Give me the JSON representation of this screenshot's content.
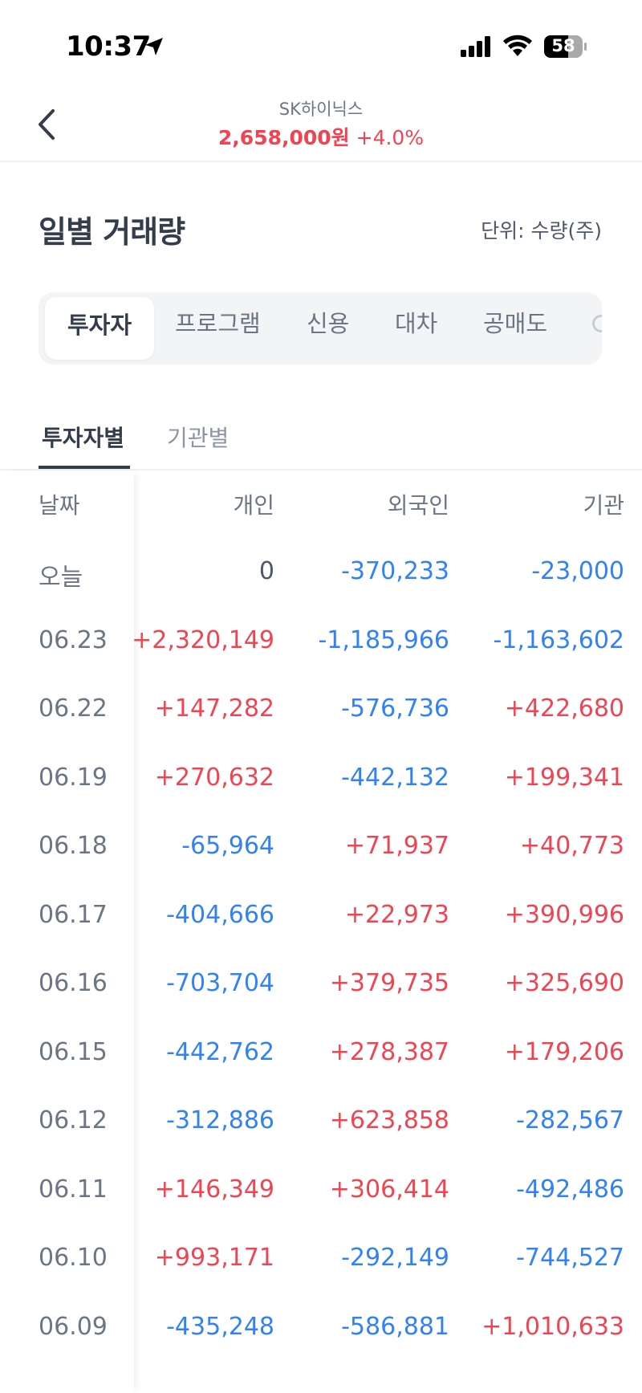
{
  "status_bar": {
    "time": "10:37",
    "battery": "58"
  },
  "header": {
    "stock_name": "SK하이닉스",
    "price": "2,658,000원",
    "change": "+4.0%"
  },
  "section": {
    "title": "일별 거래량",
    "unit": "단위: 수량(주)"
  },
  "segment_tabs": [
    "투자자",
    "프로그램",
    "신용",
    "대차",
    "공매도"
  ],
  "sub_tabs": [
    "투자자별",
    "기관별"
  ],
  "table": {
    "headers": [
      "날짜",
      "개인",
      "외국인",
      "기관"
    ],
    "rows": [
      {
        "date": "오늘",
        "individual": "0",
        "foreign": "-370,233",
        "institution": "-23,000"
      },
      {
        "date": "06.23",
        "individual": "+2,320,149",
        "foreign": "-1,185,966",
        "institution": "-1,163,602"
      },
      {
        "date": "06.22",
        "individual": "+147,282",
        "foreign": "-576,736",
        "institution": "+422,680"
      },
      {
        "date": "06.19",
        "individual": "+270,632",
        "foreign": "-442,132",
        "institution": "+199,341"
      },
      {
        "date": "06.18",
        "individual": "-65,964",
        "foreign": "+71,937",
        "institution": "+40,773"
      },
      {
        "date": "06.17",
        "individual": "-404,666",
        "foreign": "+22,973",
        "institution": "+390,996"
      },
      {
        "date": "06.16",
        "individual": "-703,704",
        "foreign": "+379,735",
        "institution": "+325,690"
      },
      {
        "date": "06.15",
        "individual": "-442,762",
        "foreign": "+278,387",
        "institution": "+179,206"
      },
      {
        "date": "06.12",
        "individual": "-312,886",
        "foreign": "+623,858",
        "institution": "-282,567"
      },
      {
        "date": "06.11",
        "individual": "+146,349",
        "foreign": "+306,414",
        "institution": "-492,486"
      },
      {
        "date": "06.10",
        "individual": "+993,171",
        "foreign": "-292,149",
        "institution": "-744,527"
      },
      {
        "date": "06.09",
        "individual": "-435,248",
        "foreign": "-586,881",
        "institution": "+1,010,633"
      }
    ]
  },
  "colors": {
    "positive": "#f04452",
    "negative": "#3182f6",
    "text_primary": "#333d4b",
    "text_secondary": "#6b7684"
  },
  "icons": {
    "back": "chevron-left-icon",
    "location": "location-arrow-icon",
    "signal": "cellular-signal-icon",
    "wifi": "wifi-icon",
    "battery": "battery-icon"
  }
}
